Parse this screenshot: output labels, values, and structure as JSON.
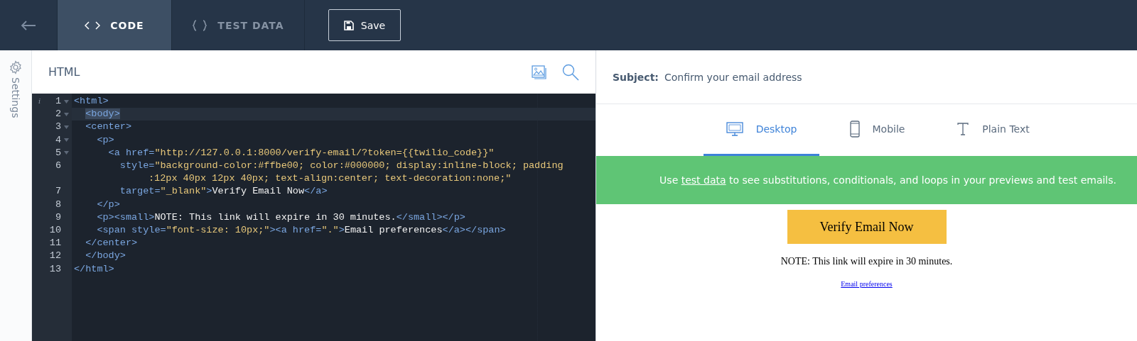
{
  "top_bar": {
    "tabs": [
      {
        "label": "CODE",
        "kind": "code",
        "selected": true
      },
      {
        "label": "TEST DATA",
        "kind": "data",
        "selected": false
      }
    ],
    "save_button": "Save"
  },
  "sidebar": {
    "settings_label": "Settings"
  },
  "editor": {
    "title": "HTML",
    "lines": [
      {
        "number": "1",
        "gutter_mark": "i",
        "foldable": true,
        "active": false,
        "tokens": [
          {
            "kind": "tag",
            "text": "<html>"
          }
        ]
      },
      {
        "number": "2",
        "foldable": true,
        "active": true,
        "tokens": [
          {
            "kind": "tag-selected",
            "text": "  <body>"
          }
        ]
      },
      {
        "number": "3",
        "foldable": true,
        "active": false,
        "tokens": [
          {
            "kind": "tag",
            "text": "  <center>"
          }
        ]
      },
      {
        "number": "4",
        "foldable": true,
        "active": false,
        "tokens": [
          {
            "kind": "tag",
            "text": "    <p>"
          }
        ]
      },
      {
        "number": "5",
        "foldable": true,
        "active": false,
        "tokens": [
          {
            "kind": "tag",
            "text": "      <a "
          },
          {
            "kind": "attr",
            "text": "href="
          },
          {
            "kind": "string",
            "text": "\"http://127.0.0.1:8000/verify-email/?token={{twilio_code}}\""
          }
        ]
      },
      {
        "number": "6",
        "foldable": false,
        "active": false,
        "tokens": [
          {
            "kind": "attr",
            "text": "        style="
          },
          {
            "kind": "string",
            "text": "\"background-color:#ffbe00; color:#000000; display:inline-block; padding"
          },
          {
            "kind": "wrap",
            "text": ":12px 40px 12px 40px; text-align:center; text-decoration:none;\""
          }
        ]
      },
      {
        "number": "7",
        "foldable": false,
        "active": false,
        "tokens": [
          {
            "kind": "attr",
            "text": "        target="
          },
          {
            "kind": "string",
            "text": "\"_blank\""
          },
          {
            "kind": "tag",
            "text": ">"
          },
          {
            "kind": "text",
            "text": "Verify Email Now"
          },
          {
            "kind": "tag",
            "text": "</a>"
          }
        ]
      },
      {
        "number": "8",
        "foldable": false,
        "active": false,
        "tokens": [
          {
            "kind": "tag",
            "text": "    </p>"
          }
        ]
      },
      {
        "number": "9",
        "foldable": false,
        "active": false,
        "tokens": [
          {
            "kind": "tag",
            "text": "    <p><small>"
          },
          {
            "kind": "text",
            "text": "NOTE: This link will expire in 30 minutes."
          },
          {
            "kind": "tag",
            "text": "</small></p>"
          }
        ]
      },
      {
        "number": "10",
        "foldable": false,
        "active": false,
        "tokens": [
          {
            "kind": "tag",
            "text": "    <span "
          },
          {
            "kind": "attr",
            "text": "style="
          },
          {
            "kind": "string",
            "text": "\"font-size: 10px;\""
          },
          {
            "kind": "tag",
            "text": "><a "
          },
          {
            "kind": "attr",
            "text": "href="
          },
          {
            "kind": "string",
            "text": "\".\""
          },
          {
            "kind": "tag",
            "text": ">"
          },
          {
            "kind": "text",
            "text": "Email preferences"
          },
          {
            "kind": "tag",
            "text": "</a></span>"
          }
        ]
      },
      {
        "number": "11",
        "foldable": false,
        "active": false,
        "tokens": [
          {
            "kind": "tag",
            "text": "  </center>"
          }
        ]
      },
      {
        "number": "12",
        "foldable": false,
        "active": false,
        "tokens": [
          {
            "kind": "tag",
            "text": "  </body>"
          }
        ]
      },
      {
        "number": "13",
        "foldable": false,
        "active": false,
        "tokens": [
          {
            "kind": "tag",
            "text": "</html>"
          }
        ]
      }
    ]
  },
  "preview": {
    "subject_label": "Subject:",
    "subject": "Confirm your email address",
    "tabs": [
      {
        "label": "Desktop",
        "kind": "desktop",
        "selected": true
      },
      {
        "label": "Mobile",
        "kind": "mobile",
        "selected": false
      },
      {
        "label": "Plain Text",
        "kind": "text",
        "selected": false
      }
    ],
    "banner": {
      "before": "Use",
      "link": "test data",
      "after": "to see substitutions, conditionals, and loops in your previews and test emails."
    },
    "email": {
      "button": "Verify Email Now",
      "note": "NOTE: This link will expire in 30 minutes.",
      "link": "Email preferences"
    }
  }
}
